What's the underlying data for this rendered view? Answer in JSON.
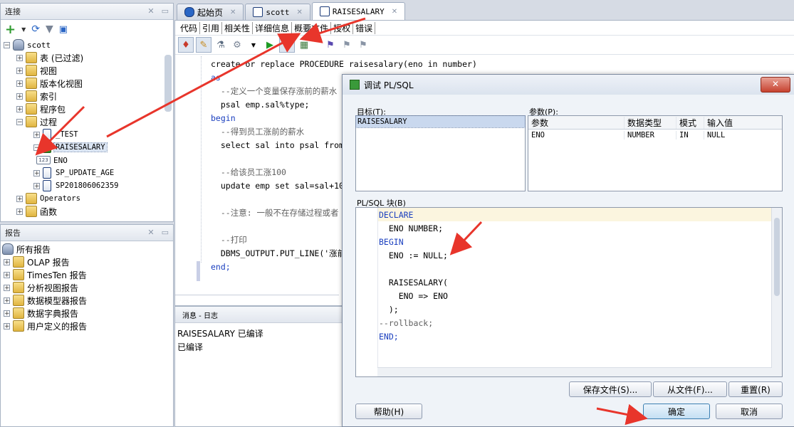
{
  "connections_panel": {
    "title": "连接",
    "tree": {
      "root": "scott",
      "items": [
        {
          "label": "表 (已过滤)",
          "icon": "table-icon"
        },
        {
          "label": "视图",
          "icon": "view-icon"
        },
        {
          "label": "版本化视图",
          "icon": "view-icon"
        },
        {
          "label": "索引",
          "icon": "index-icon"
        },
        {
          "label": "程序包",
          "icon": "package-icon"
        },
        {
          "label": "过程",
          "icon": "procedure-folder-icon"
        }
      ],
      "procedures": [
        {
          "label": "_TEST"
        },
        {
          "label": "RAISESALARY",
          "selected": true
        },
        {
          "label": "SP_UPDATE_AGE"
        },
        {
          "label": "SP201806062359"
        }
      ],
      "param": "ENO",
      "param_icon_text": "123",
      "after": [
        {
          "label": "Operators"
        },
        {
          "label": "函数"
        }
      ]
    }
  },
  "reports_panel": {
    "title": "报告",
    "root": "所有报告",
    "items": [
      "OLAP 报告",
      "TimesTen 报告",
      "分析视图报告",
      "数据模型器报告",
      "数据字典报告",
      "用户定义的报告"
    ]
  },
  "editor_tabs": [
    {
      "label": "起始页",
      "icon": "help-icon"
    },
    {
      "label": "scott",
      "icon": "sql-icon"
    },
    {
      "label": "RAISESALARY",
      "icon": "procedure-icon",
      "active": true
    }
  ],
  "subtabs": [
    "代码",
    "引用",
    "相关性",
    "详细信息",
    "概要文件",
    "授权",
    "错误"
  ],
  "code_lines": [
    {
      "text": "create or replace PROCEDURE raisesalary(eno in number)",
      "type": "code"
    },
    {
      "text": "as",
      "type": "kw"
    },
    {
      "text": "  --定义一个变量保存涨前的薪水",
      "type": "comment"
    },
    {
      "text": "  psal emp.sal%type;",
      "type": "code"
    },
    {
      "text": "begin",
      "type": "kw"
    },
    {
      "text": "  --得到员工涨前的薪水",
      "type": "comment"
    },
    {
      "text": "  select sal into psal from",
      "type": "code"
    },
    {
      "text": "",
      "type": "code"
    },
    {
      "text": "  --给该员工涨100",
      "type": "comment"
    },
    {
      "text": "  update emp set sal=sal+10",
      "type": "code"
    },
    {
      "text": "",
      "type": "code"
    },
    {
      "text": "  --注意: 一般不在存储过程或者",
      "type": "comment"
    },
    {
      "text": "",
      "type": "code"
    },
    {
      "text": "  --打印",
      "type": "comment"
    },
    {
      "text": "  DBMS_OUTPUT.PUT_LINE('涨前",
      "type": "code"
    },
    {
      "text": "end;",
      "type": "kw"
    }
  ],
  "messages": {
    "title": "消息 - 日志",
    "lines": [
      "RAISESALARY 已编译",
      "已编译"
    ]
  },
  "dialog": {
    "title": "调试 PL/SQL",
    "target_label": "目标(T):",
    "target_item": "RAISESALARY",
    "params_label": "参数(P):",
    "param_headers": [
      "参数",
      "数据类型",
      "模式",
      "输入值"
    ],
    "param_rows": [
      [
        "ENO",
        "NUMBER",
        "IN",
        "NULL"
      ]
    ],
    "block_label": "PL/SQL 块(B)",
    "block_lines": [
      {
        "text": "DECLARE",
        "type": "kw"
      },
      {
        "text": "  ENO NUMBER;",
        "type": "code"
      },
      {
        "text": "BEGIN",
        "type": "kw"
      },
      {
        "text": "  ENO := NULL;",
        "type": "code"
      },
      {
        "text": "",
        "type": "code"
      },
      {
        "text": "  RAISESALARY(",
        "type": "code"
      },
      {
        "text": "    ENO => ENO",
        "type": "code"
      },
      {
        "text": "  );",
        "type": "code"
      },
      {
        "text": "--rollback;",
        "type": "comment"
      },
      {
        "text": "END;",
        "type": "kw"
      }
    ],
    "buttons": {
      "save_file": "保存文件(S)...",
      "from_file": "从文件(F)...",
      "reset": "重置(R)",
      "help": "帮助(H)",
      "ok": "确定",
      "cancel": "取消"
    }
  },
  "colors": {
    "arrow": "#e8352b",
    "keyword": "#1a3fbf",
    "selection": "#dbe5f3"
  }
}
